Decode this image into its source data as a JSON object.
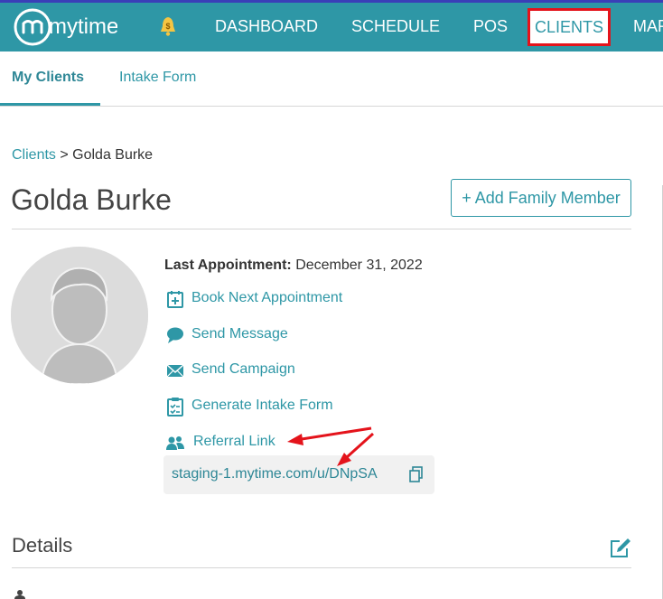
{
  "brand": {
    "logo_text": "mytime",
    "accent": "#2e97a6",
    "highlight": "#e4131b"
  },
  "nav": {
    "items": [
      {
        "label": "DASHBOARD"
      },
      {
        "label": "SCHEDULE"
      },
      {
        "label": "POS"
      },
      {
        "label": "CLIENTS",
        "active": true
      },
      {
        "label": "MAR"
      }
    ],
    "bell_badge": "$"
  },
  "subnav": {
    "tabs": [
      {
        "label": "My Clients",
        "active": true
      },
      {
        "label": "Intake Form"
      }
    ]
  },
  "breadcrumb": {
    "root": "Clients",
    "separator": " > ",
    "current": "Golda Burke"
  },
  "client": {
    "name": "Golda Burke",
    "add_family_label": "+ Add Family Member",
    "last_appointment_label": "Last Appointment:",
    "last_appointment_value": "December 31, 2022"
  },
  "actions": [
    {
      "label": "Book Next Appointment",
      "icon": "calendar-plus-icon"
    },
    {
      "label": "Send Message",
      "icon": "chat-bubble-icon"
    },
    {
      "label": "Send Campaign",
      "icon": "envelope-icon"
    },
    {
      "label": "Generate Intake Form",
      "icon": "clipboard-check-icon"
    },
    {
      "label": "Referral Link",
      "icon": "users-icon"
    }
  ],
  "referral": {
    "url": "staging-1.mytime.com/u/DNpSA"
  },
  "details": {
    "heading": "Details"
  }
}
